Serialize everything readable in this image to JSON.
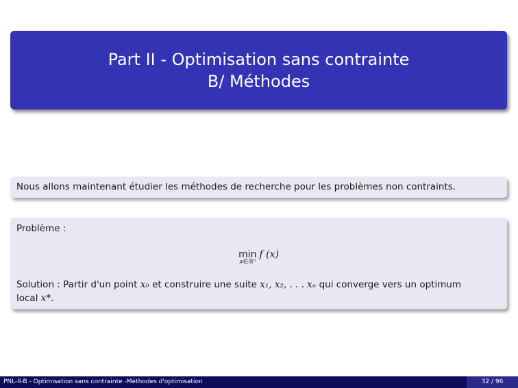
{
  "title": {
    "line1": "Part II - Optimisation sans contrainte",
    "line2": "B/ Méthodes"
  },
  "intro_text": "Nous allons maintenant étudier les méthodes de recherche pour les problèmes non contraints.",
  "problem": {
    "label": "Problème   :",
    "formula_min": "min",
    "formula_sub": "x∈ℝⁿ",
    "formula_fx": "f (x)"
  },
  "solution": {
    "label": "Solution",
    "text_before_x0": "  : Partir d'un point ",
    "x0": "x₀",
    "text_middle": " et construire une suite ",
    "seq": "x₁, x₂, . . . xₙ",
    "text_after_seq": " qui converge vers un optimum local ",
    "xstar": "x*",
    "period": "."
  },
  "footer": {
    "left": "PNL-II-B - Optimisation sans contrainte -Méthodes d'optimisation",
    "page": "32 / 96"
  },
  "colors": {
    "title_bg": "#3333b3",
    "box_bg": "#e8e8f3",
    "footer_bg": "#0d0d5c"
  }
}
